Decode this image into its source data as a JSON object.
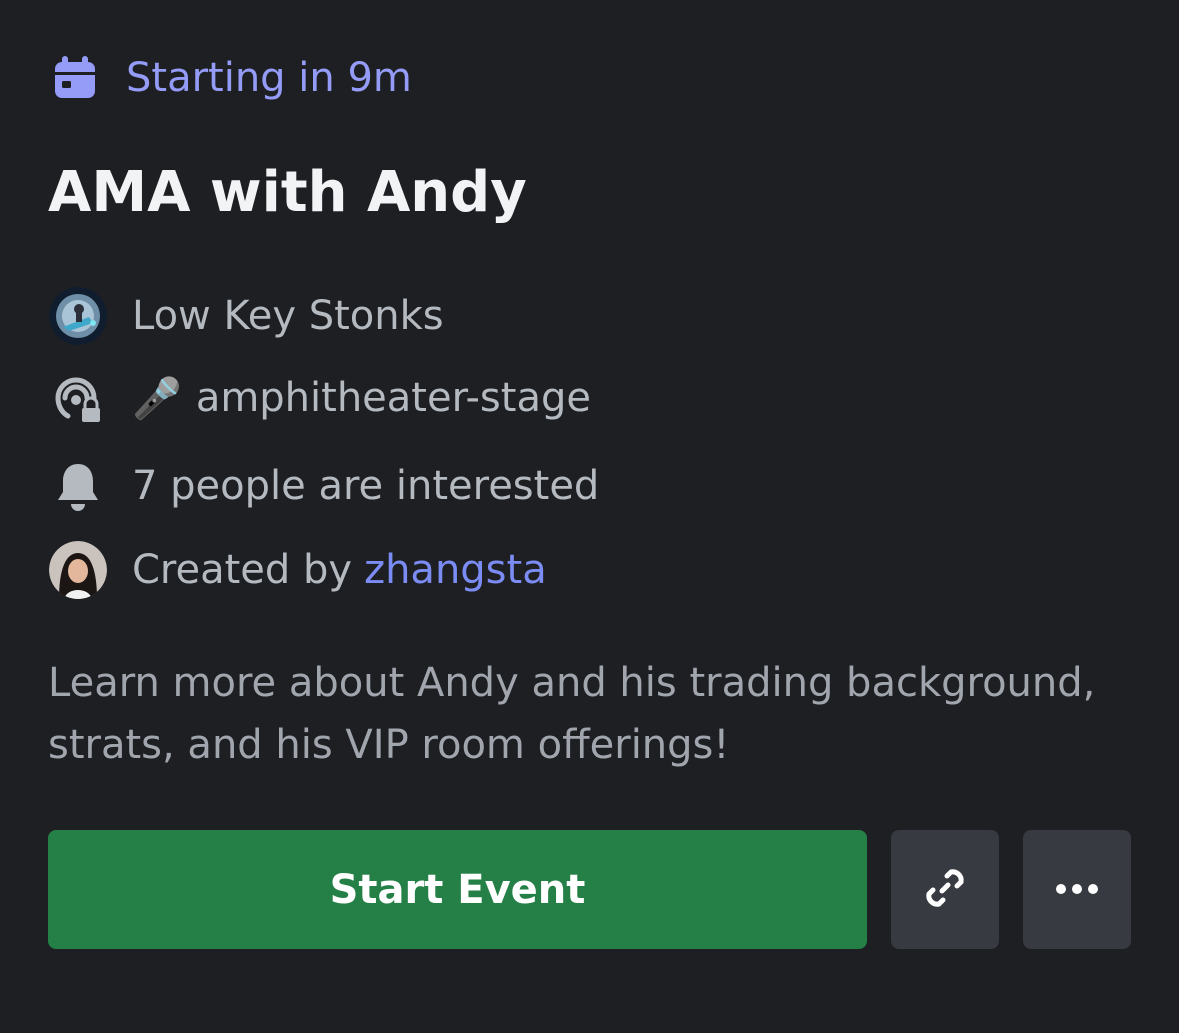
{
  "event": {
    "status": "Starting in 9m",
    "title": "AMA with Andy",
    "server": "Low Key Stonks",
    "channel_emoji": "🎤",
    "channel": "amphitheater-stage",
    "interested": "7 people are interested",
    "created_by_prefix": "Created by",
    "creator": "zhangsta",
    "description": "Learn more about Andy and his trading background, strats, and his VIP room offerings!"
  },
  "actions": {
    "start_label": "Start Event",
    "copy_link_icon": "link-icon",
    "more_icon": "more-horizontal-icon"
  },
  "colors": {
    "background": "#1e1f22",
    "accent_status": "#949cf7",
    "creator_link": "#7b8cf5",
    "start_button": "#248046",
    "secondary_button": "#383a42"
  }
}
